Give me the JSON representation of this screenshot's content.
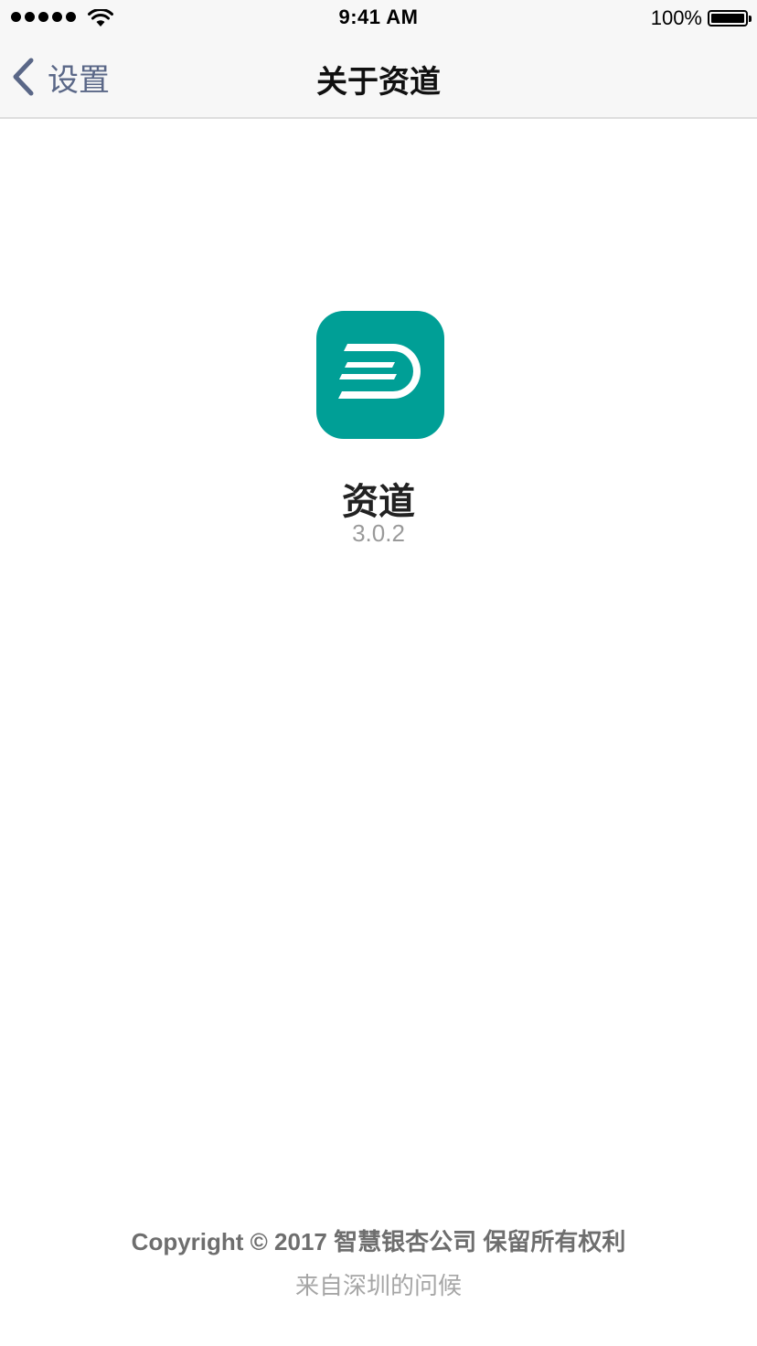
{
  "status_bar": {
    "time": "9:41 AM",
    "battery_percent_label": "100%",
    "battery_level": 1.0,
    "signal_bars": 5,
    "icons": [
      "signal-dots-icon",
      "wifi-icon",
      "battery-icon"
    ]
  },
  "nav": {
    "back_label": "设置",
    "title": "关于资道",
    "back_icon": "chevron-left-icon"
  },
  "app": {
    "name": "资道",
    "version": "3.0.2",
    "icon": "app-logo-icon",
    "icon_color": "#009f96"
  },
  "footer": {
    "copyright": "Copyright © 2017 智慧银杏公司 保留所有权利",
    "greeting": "来自深圳的问候"
  },
  "colors": {
    "nav_background": "#f7f7f7",
    "back_tint": "#5a6787",
    "brand": "#009f96"
  }
}
